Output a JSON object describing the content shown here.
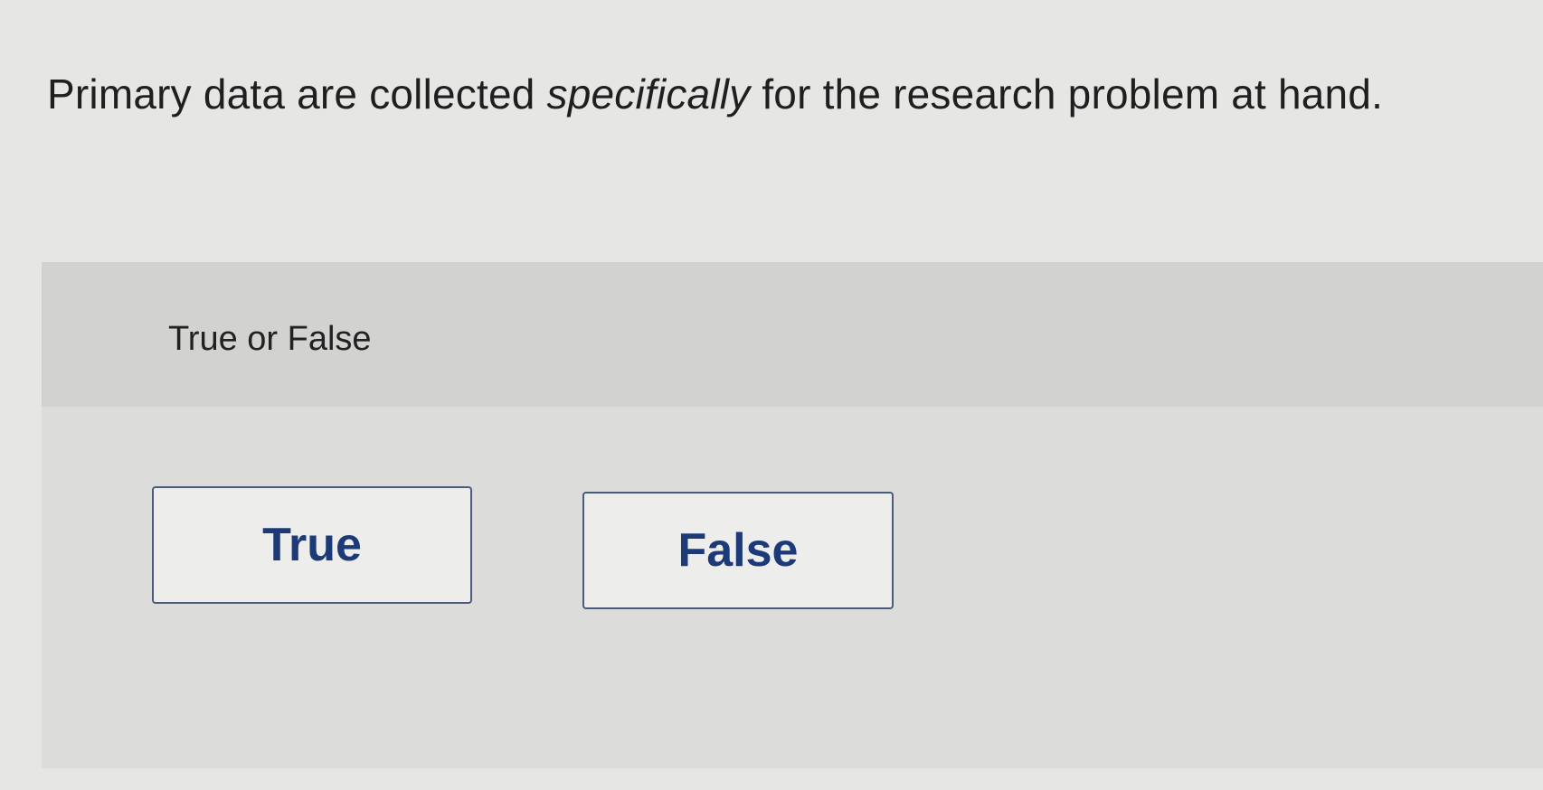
{
  "question": {
    "before": "Primary data are collected ",
    "emphasis": "specifically",
    "after": " for the research problem at hand."
  },
  "prompt": "True or False",
  "choices": [
    {
      "label": "True"
    },
    {
      "label": "False"
    }
  ],
  "colors": {
    "page_background": "#e6e6e4",
    "panel_background": "#dcdcda",
    "panel_header_background": "#d2d2d0",
    "button_border": "#4a5b7e",
    "button_text": "#1d3a78"
  }
}
